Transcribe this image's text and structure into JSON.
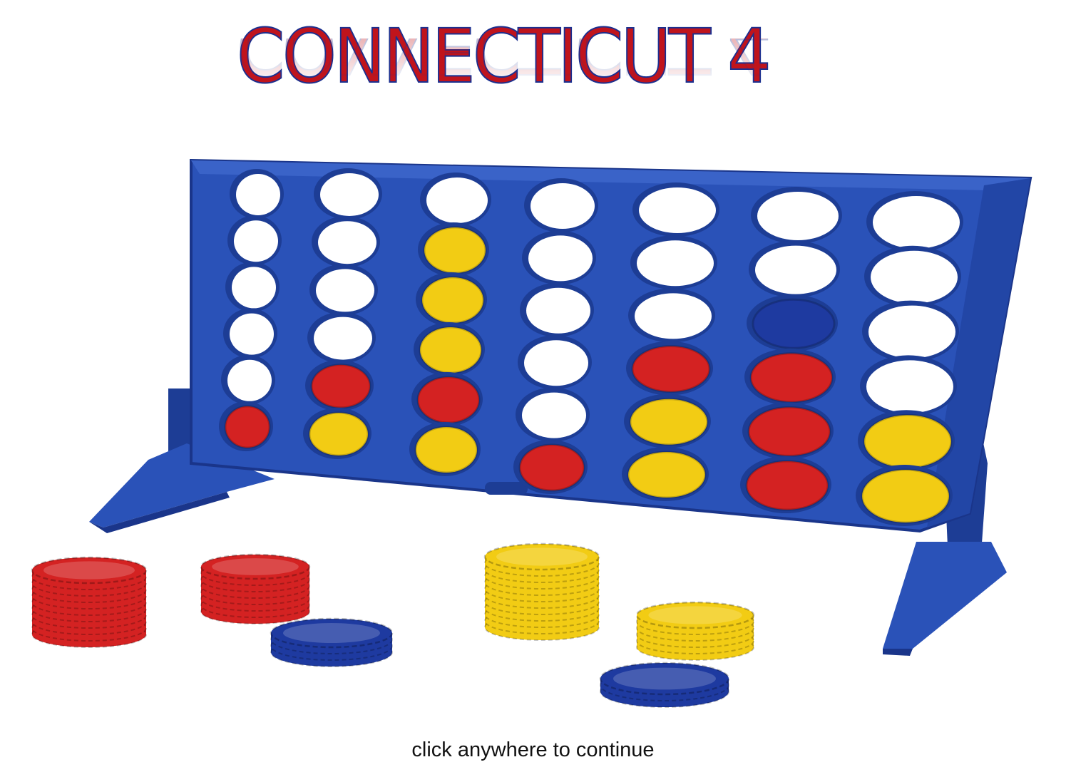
{
  "title": "CONNECTICUT 4",
  "continue_prompt": "click anywhere to continue",
  "colors": {
    "board": "#2a52b8",
    "board_dark": "#1d3d95",
    "red": "#d42222",
    "yellow": "#f2cc14",
    "blue_disc": "#1e3aa0",
    "title_fill": "#c0141c",
    "title_outline": "#1b2f8f"
  },
  "board": {
    "columns": 7,
    "rows": 6,
    "grid": [
      [
        "empty",
        "empty",
        "empty",
        "empty",
        "empty",
        "empty",
        "empty"
      ],
      [
        "empty",
        "empty",
        "yellow",
        "empty",
        "empty",
        "empty",
        "empty"
      ],
      [
        "empty",
        "empty",
        "yellow",
        "empty",
        "empty",
        "blue",
        "empty"
      ],
      [
        "empty",
        "empty",
        "yellow",
        "empty",
        "red",
        "red",
        "empty"
      ],
      [
        "empty",
        "red",
        "red",
        "empty",
        "yellow",
        "red",
        "yellow"
      ],
      [
        "red",
        "yellow",
        "yellow",
        "red",
        "yellow",
        "red",
        "yellow"
      ]
    ]
  },
  "stacks": [
    {
      "color": "red",
      "discs": 10
    },
    {
      "color": "red",
      "discs": 7
    },
    {
      "color": "blue",
      "discs": 3
    },
    {
      "color": "yellow",
      "discs": 11
    },
    {
      "color": "yellow",
      "discs": 5
    },
    {
      "color": "blue",
      "discs": 2
    }
  ]
}
